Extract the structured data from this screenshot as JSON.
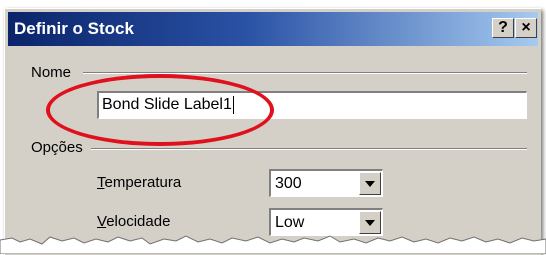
{
  "window": {
    "title": "Definir o Stock",
    "help_label": "?",
    "close_label": "×"
  },
  "nome_group": {
    "label": "Nome",
    "name_field": {
      "value": "Bond Slide Label1"
    }
  },
  "opcoes_group": {
    "label": "Opções",
    "temperatura": {
      "mnemonic": "T",
      "label_rest": "emperatura",
      "value": "300"
    },
    "velocidade": {
      "mnemonic": "V",
      "label_rest": "elocidade",
      "value": "Low"
    }
  },
  "colors": {
    "title_bar_start": "#0a246a",
    "title_bar_end": "#a6caf0",
    "dialog_face": "#d4d0c8",
    "highlight_oval": "#e0101c"
  }
}
